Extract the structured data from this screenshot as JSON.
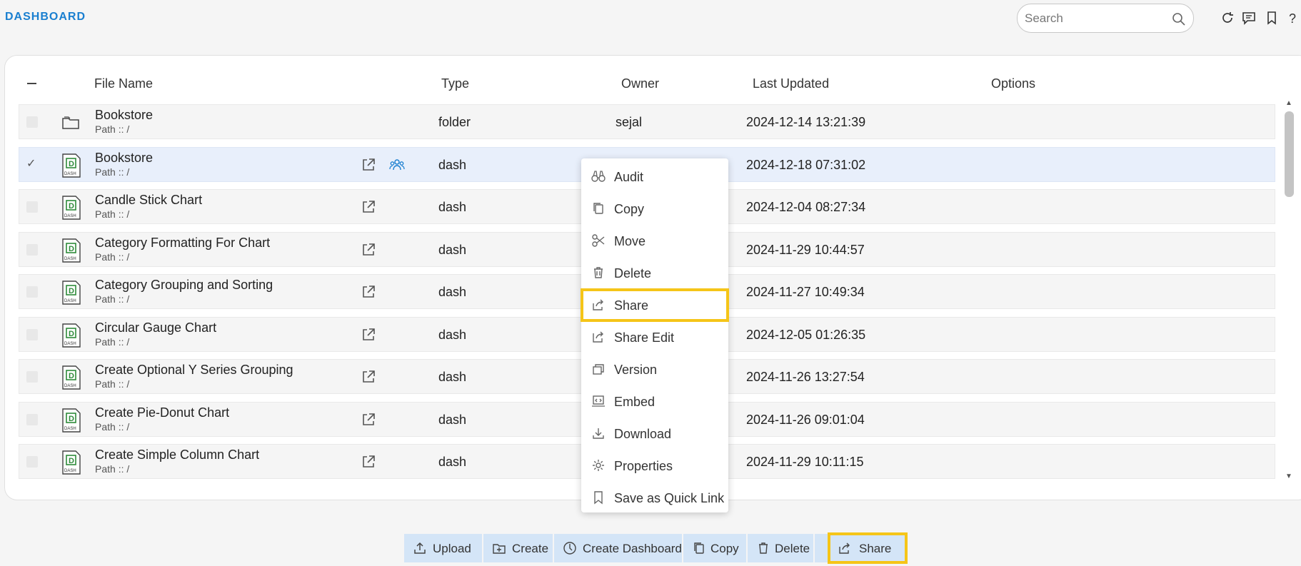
{
  "app": {
    "title": "DASHBOARD"
  },
  "search": {
    "placeholder": "Search"
  },
  "table": {
    "headers": {
      "file_name": "File Name",
      "type": "Type",
      "owner": "Owner",
      "last_updated": "Last Updated",
      "options": "Options"
    },
    "rows": [
      {
        "name": "Bookstore",
        "path": "Path :: /",
        "type": "folder",
        "owner": "sejal",
        "updated": "2024-12-14 13:21:39",
        "icon": "folder-icon",
        "selected": false
      },
      {
        "name": "Bookstore",
        "path": "Path :: /",
        "type": "dash",
        "owner": "",
        "updated": "2024-12-18 07:31:02",
        "icon": "dashboard-file-icon",
        "selected": true
      },
      {
        "name": "Candle Stick Chart",
        "path": "Path :: /",
        "type": "dash",
        "owner": "",
        "updated": "2024-12-04 08:27:34",
        "icon": "dashboard-file-icon",
        "selected": false
      },
      {
        "name": "Category Formatting For Chart",
        "path": "Path :: /",
        "type": "dash",
        "owner": "",
        "updated": "2024-11-29 10:44:57",
        "icon": "dashboard-file-icon",
        "selected": false
      },
      {
        "name": "Category Grouping and Sorting",
        "path": "Path :: /",
        "type": "dash",
        "owner": "",
        "updated": "2024-11-27 10:49:34",
        "icon": "dashboard-file-icon",
        "selected": false
      },
      {
        "name": "Circular Gauge Chart",
        "path": "Path :: /",
        "type": "dash",
        "owner": "",
        "updated": "2024-12-05 01:26:35",
        "icon": "dashboard-file-icon",
        "selected": false
      },
      {
        "name": "Create Optional Y Series Grouping",
        "path": "Path :: /",
        "type": "dash",
        "owner": "",
        "updated": "2024-11-26 13:27:54",
        "icon": "dashboard-file-icon",
        "selected": false
      },
      {
        "name": "Create Pie-Donut Chart",
        "path": "Path :: /",
        "type": "dash",
        "owner": "",
        "updated": "2024-11-26 09:01:04",
        "icon": "dashboard-file-icon",
        "selected": false
      },
      {
        "name": "Create Simple Column Chart",
        "path": "Path :: /",
        "type": "dash",
        "owner": "",
        "updated": "2024-11-29 10:11:15",
        "icon": "dashboard-file-icon",
        "selected": false
      }
    ]
  },
  "context_menu": {
    "items": [
      {
        "label": "Audit",
        "icon": "binoculars-icon",
        "highlighted": false
      },
      {
        "label": "Copy",
        "icon": "copy-icon",
        "highlighted": false
      },
      {
        "label": "Move",
        "icon": "scissors-icon",
        "highlighted": false
      },
      {
        "label": "Delete",
        "icon": "trash-icon",
        "highlighted": false
      },
      {
        "label": "Share",
        "icon": "share-icon",
        "highlighted": true
      },
      {
        "label": "Share Edit",
        "icon": "share-edit-icon",
        "highlighted": false
      },
      {
        "label": "Version",
        "icon": "version-icon",
        "highlighted": false
      },
      {
        "label": "Embed",
        "icon": "embed-icon",
        "highlighted": false
      },
      {
        "label": "Download",
        "icon": "download-icon",
        "highlighted": false
      },
      {
        "label": "Properties",
        "icon": "gear-icon",
        "highlighted": false
      },
      {
        "label": "Save as Quick Link",
        "icon": "bookmark-icon",
        "highlighted": false
      }
    ]
  },
  "toolbar": {
    "upload": "Upload",
    "create": "Create",
    "create_dashboard": "Create Dashboard",
    "copy": "Copy",
    "delete": "Delete",
    "share": "Share"
  },
  "colors": {
    "accent": "#1a7fd0",
    "highlight": "#f5c518",
    "toolbar_bg": "#d4e5f7",
    "selected_row": "#e8effb",
    "file_icon_green": "#2e8b3a"
  }
}
